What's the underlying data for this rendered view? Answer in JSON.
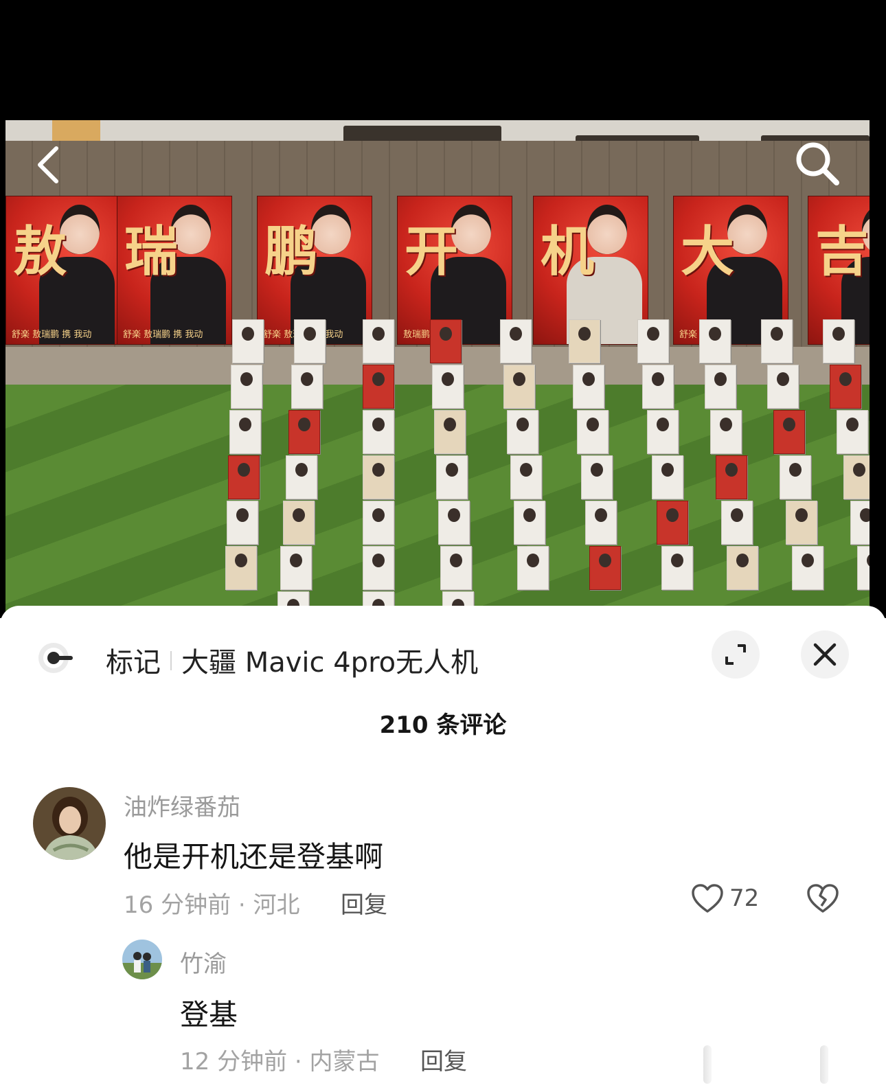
{
  "video": {
    "banners": [
      {
        "char": "敖",
        "footer": "舒楽 敖瑞鹏 携 我动",
        "outfit": "dark"
      },
      {
        "char": "瑞",
        "footer": "舒楽 敖瑞鹏 携 我动",
        "outfit": "dark"
      },
      {
        "char": "鹏",
        "footer": "舒楽 敖瑞鹏 携 我动",
        "outfit": "dark"
      },
      {
        "char": "开",
        "footer": "敖瑞鹏",
        "outfit": "dark"
      },
      {
        "char": "机",
        "footer": "",
        "outfit": "light"
      },
      {
        "char": "大",
        "footer": "舒楽",
        "outfit": "dark"
      },
      {
        "char": "吉",
        "footer": "",
        "outfit": "dark"
      }
    ],
    "back_icon": "chevron-left-icon",
    "search_icon": "search-icon"
  },
  "panel": {
    "mark_label": "标记",
    "mark_device": "大疆 Mavic 4pro无人机",
    "mark_icon": "target-icon",
    "expand_icon": "expand-icon",
    "close_icon": "close-icon",
    "comment_count": "210 条评论"
  },
  "comments": [
    {
      "username": "油炸绿番茄",
      "text": "他是开机还是登基啊",
      "meta": "16 分钟前 · 河北",
      "reply_label": "回复",
      "likes": "72"
    }
  ],
  "replies": [
    {
      "username": "竹渝",
      "text": "登基",
      "meta": "12 分钟前 · 内蒙古",
      "reply_label": "回复"
    }
  ],
  "colors": {
    "banner_red": "#c8241c",
    "banner_gold": "#f6d28a",
    "text_primary": "#161616",
    "text_secondary": "#9a9a9a"
  }
}
